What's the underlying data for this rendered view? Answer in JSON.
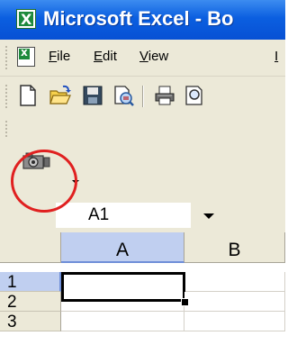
{
  "title_bar": {
    "title": "Microsoft Excel - Bo"
  },
  "menu_bar": {
    "items": [
      {
        "label": "File",
        "mnemonic": "F"
      },
      {
        "label": "Edit",
        "mnemonic": "E"
      },
      {
        "label": "View",
        "mnemonic": "V"
      },
      {
        "label": "I",
        "mnemonic": "I"
      }
    ]
  },
  "toolbar": {
    "buttons": [
      "new-icon",
      "open-icon",
      "save-icon",
      "permission-icon",
      "print-icon",
      "print-preview-icon"
    ]
  },
  "camera_toolbar": {
    "button_icon": "camera-icon"
  },
  "formula_bar": {
    "name_box": "A1"
  },
  "grid": {
    "columns": [
      "A",
      "B"
    ],
    "rows": [
      "1",
      "2",
      "3"
    ],
    "active_cell": "A1"
  },
  "colors": {
    "title_bar": "#0b5fe0",
    "highlight_circle": "#e02020",
    "active_header": "#c0cff0"
  }
}
